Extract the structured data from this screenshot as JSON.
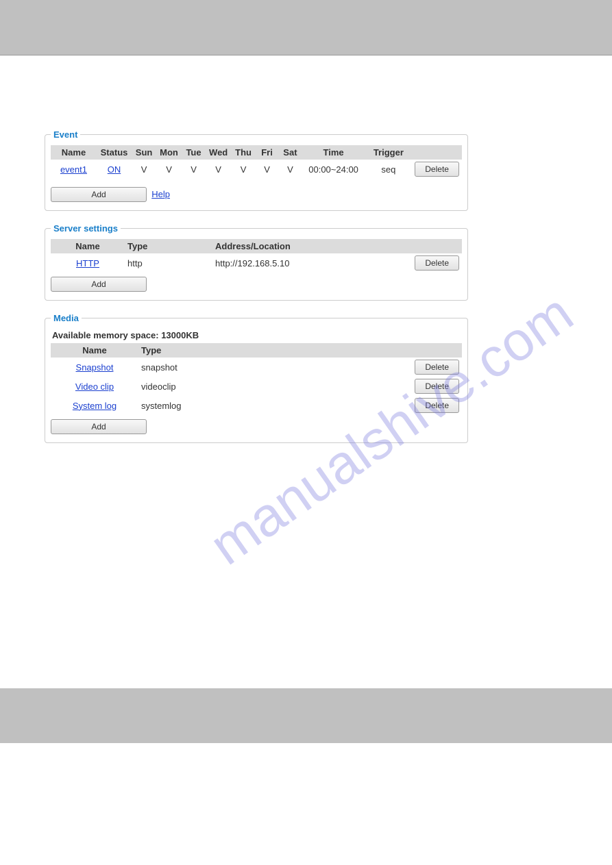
{
  "watermark": "manualshive.com",
  "event": {
    "legend": "Event",
    "headers": {
      "name": "Name",
      "status": "Status",
      "sun": "Sun",
      "mon": "Mon",
      "tue": "Tue",
      "wed": "Wed",
      "thu": "Thu",
      "fri": "Fri",
      "sat": "Sat",
      "time": "Time",
      "trigger": "Trigger"
    },
    "row": {
      "name": "event1",
      "status": "ON",
      "sun": "V",
      "mon": "V",
      "tue": "V",
      "wed": "V",
      "thu": "V",
      "fri": "V",
      "sat": "V",
      "time": "00:00~24:00",
      "trigger": "seq",
      "delete": "Delete"
    },
    "add": "Add",
    "help": "Help"
  },
  "server": {
    "legend": "Server settings",
    "headers": {
      "name": "Name",
      "type": "Type",
      "addr": "Address/Location"
    },
    "row": {
      "name": "HTTP",
      "type": "http",
      "addr": "http://192.168.5.10",
      "delete": "Delete"
    },
    "add": "Add"
  },
  "media": {
    "legend": "Media",
    "memspace": "Available memory space: 13000KB",
    "headers": {
      "name": "Name",
      "type": "Type"
    },
    "rows": {
      "r1": {
        "name": "Snapshot",
        "type": "snapshot",
        "delete": "Delete"
      },
      "r2": {
        "name": "Video clip",
        "type": "videoclip",
        "delete": "Delete"
      },
      "r3": {
        "name": "System log",
        "type": "systemlog",
        "delete": "Delete"
      }
    },
    "add": "Add"
  }
}
